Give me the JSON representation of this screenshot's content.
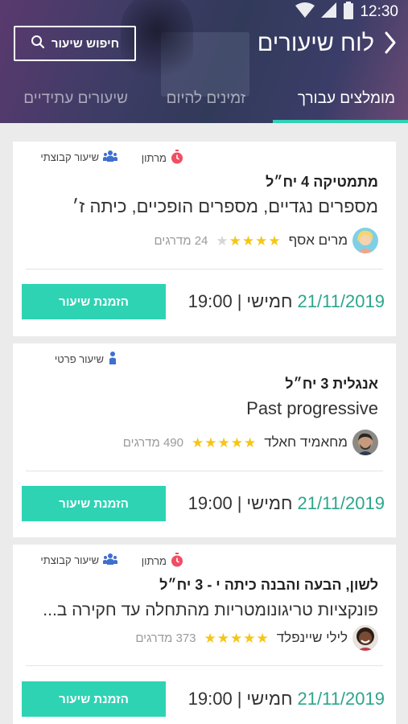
{
  "status_bar": {
    "time": "12:30"
  },
  "header": {
    "title": "לוח שיעורים",
    "search_label": "חיפוש שיעור"
  },
  "tabs": [
    {
      "label": "מומלצים עבורך",
      "active": true
    },
    {
      "label": "זמינים להיום",
      "active": false
    },
    {
      "label": "שיעורים עתידיים",
      "active": false
    }
  ],
  "colors": {
    "accent": "#2ed3b4",
    "date": "#2ca58d",
    "star": "#f5c518",
    "marathon_icon": "#f04e64",
    "group_icon": "#3f6fcf"
  },
  "lessons": [
    {
      "tags": {
        "type": "שיעור קבוצתי",
        "type_icon": "group-icon",
        "marathon": "מרתון"
      },
      "subject": "מתמטיקה 4 יח״ל",
      "topic": "מספרים נגדיים, מספרים הופכיים, כיתה ז׳",
      "teacher": "מרים אסף",
      "rating_stars": 4,
      "ratings_count": "24 מדרגים",
      "date": "21/11/2019",
      "day": "חמישי",
      "time": "19:00",
      "book_label": "הזמנת שיעור"
    },
    {
      "tags": {
        "type": "שיעור פרטי",
        "type_icon": "person-icon"
      },
      "subject": "אנגלית 3 יח״ל",
      "topic": "Past progressive",
      "teacher": "מחאמיד חאלד",
      "rating_stars": 5,
      "ratings_count": "490 מדרגים",
      "date": "21/11/2019",
      "day": "חמישי",
      "time": "19:00",
      "book_label": "הזמנת שיעור"
    },
    {
      "tags": {
        "type": "שיעור קבוצתי",
        "type_icon": "group-icon",
        "marathon": "מרתון"
      },
      "subject": "לשון, הבעה והבנה כיתה י - 3 יח״ל",
      "topic": "פונקציות טריגונומטריות מהתחלה עד חקירה ב...",
      "teacher": "לילי שיינפלד",
      "rating_stars": 5,
      "ratings_count": "373 מדרגים",
      "date": "21/11/2019",
      "day": "חמישי",
      "time": "19:00",
      "book_label": "הזמנת שיעור"
    }
  ]
}
